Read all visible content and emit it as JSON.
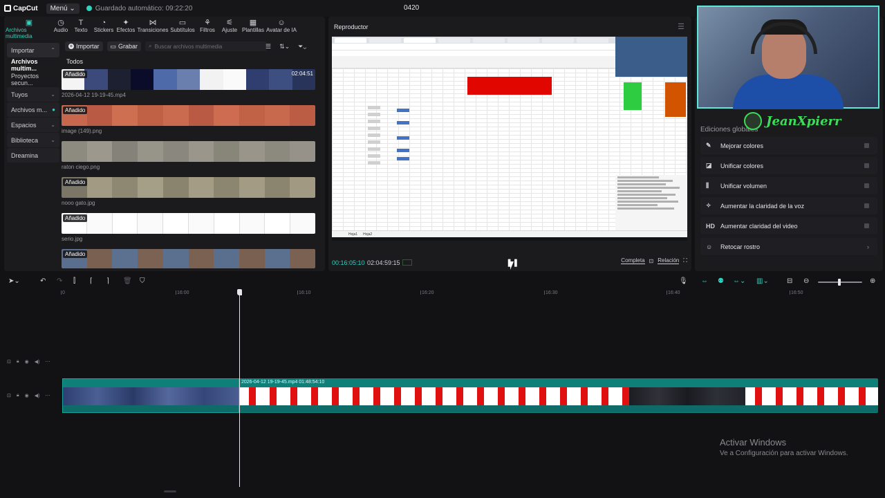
{
  "app": {
    "logo": "CapCut",
    "menu": "Menú",
    "autosave": "Guardado automático: 09:22:20",
    "project_title": "0420"
  },
  "toolbar": [
    {
      "label": "Archivos multimedia",
      "icon": "media-icon"
    },
    {
      "label": "Audio",
      "icon": "audio-icon"
    },
    {
      "label": "Texto",
      "icon": "text-icon"
    },
    {
      "label": "Stickers",
      "icon": "sticker-icon"
    },
    {
      "label": "Efectos",
      "icon": "effects-icon"
    },
    {
      "label": "Transiciones",
      "icon": "transition-icon"
    },
    {
      "label": "Subtítulos",
      "icon": "subtitles-icon"
    },
    {
      "label": "Filtros",
      "icon": "filter-icon"
    },
    {
      "label": "Ajuste",
      "icon": "adjust-icon"
    },
    {
      "label": "Plantillas",
      "icon": "templates-icon"
    },
    {
      "label": "Avatar de IA",
      "icon": "ai-avatar-icon"
    }
  ],
  "sidebar": [
    {
      "label": "Importar"
    },
    {
      "label": "Archivos multim..."
    },
    {
      "label": "Proyectos secun..."
    },
    {
      "label": "Tuyos"
    },
    {
      "label": "Archivos m..."
    },
    {
      "label": "Espacios"
    },
    {
      "label": "Biblioteca"
    },
    {
      "label": "Dreamina"
    }
  ],
  "media": {
    "import_label": "Importar",
    "record_label": "Grabar",
    "search_placeholder": "Buscar archivos multimedia",
    "section_label": "Todos",
    "added_badge": "Añadido",
    "items": [
      {
        "name": "2026-04-12 19-19-45.mp4",
        "duration": "02:04:51",
        "added": true
      },
      {
        "name": "image (149).png",
        "added": true
      },
      {
        "name": "raton ciego.png",
        "added": false
      },
      {
        "name": "nooo gato.jpg",
        "added": true
      },
      {
        "name": "serio.jpg",
        "added": true
      },
      {
        "name": "",
        "added": true
      }
    ]
  },
  "player": {
    "title": "Reproductor",
    "current_time": "00:16:05:10",
    "total_time": "02:04:59:15",
    "full_label": "Completa",
    "ratio_label": "Relación",
    "sheet_tabs": [
      "Hoja1",
      "Hoja2"
    ]
  },
  "right_panel": {
    "streamer_name": "JeanXpierr",
    "title": "Ediciones globales",
    "features": [
      {
        "label": "Mejorar colores",
        "icon": "enhance-colors-icon"
      },
      {
        "label": "Unificar colores",
        "icon": "unify-colors-icon"
      },
      {
        "label": "Unificar volumen",
        "icon": "unify-volume-icon"
      },
      {
        "label": "Aumentar la claridad de la voz",
        "icon": "voice-clarity-icon"
      },
      {
        "label": "Aumentar claridad del video",
        "icon": "hd-icon",
        "glyph": "HD"
      },
      {
        "label": "Retocar rostro",
        "icon": "face-retouch-icon"
      }
    ]
  },
  "timeline": {
    "ticks": [
      "0",
      "16:00",
      "16:10",
      "16:20",
      "16:30",
      "16:40",
      "16:50"
    ],
    "clip_label": "2026-04-12 19-19-45.mp4   01:48:54:10"
  },
  "watermark": {
    "line1": "Activar Windows",
    "line2": "Ve a Configuración para activar Windows."
  }
}
